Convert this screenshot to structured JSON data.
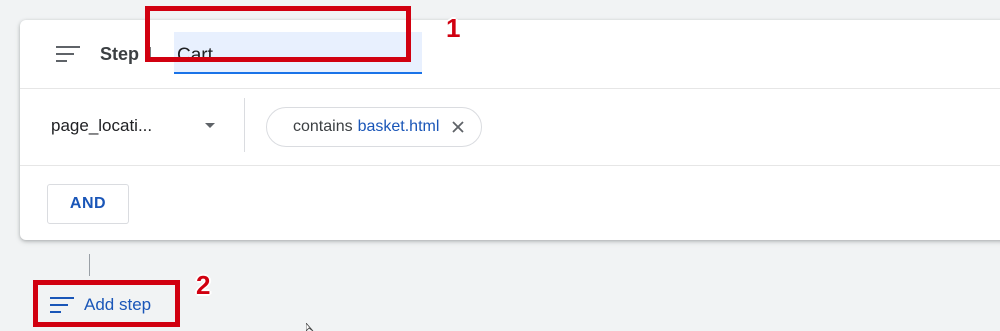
{
  "step": {
    "label": "Step 1",
    "name_value": "Cart"
  },
  "filter": {
    "dimension": "page_locati...",
    "chip_operator": "contains",
    "chip_value": "basket.html"
  },
  "and_button": "AND",
  "add_step_label": "Add step",
  "annotations": {
    "marker_1": "1",
    "marker_2": "2",
    "highlight_color": "#d10010"
  },
  "colors": {
    "accent": "#1a73e8",
    "link_text": "#1a56b8",
    "input_bg": "#e8f0fe"
  }
}
